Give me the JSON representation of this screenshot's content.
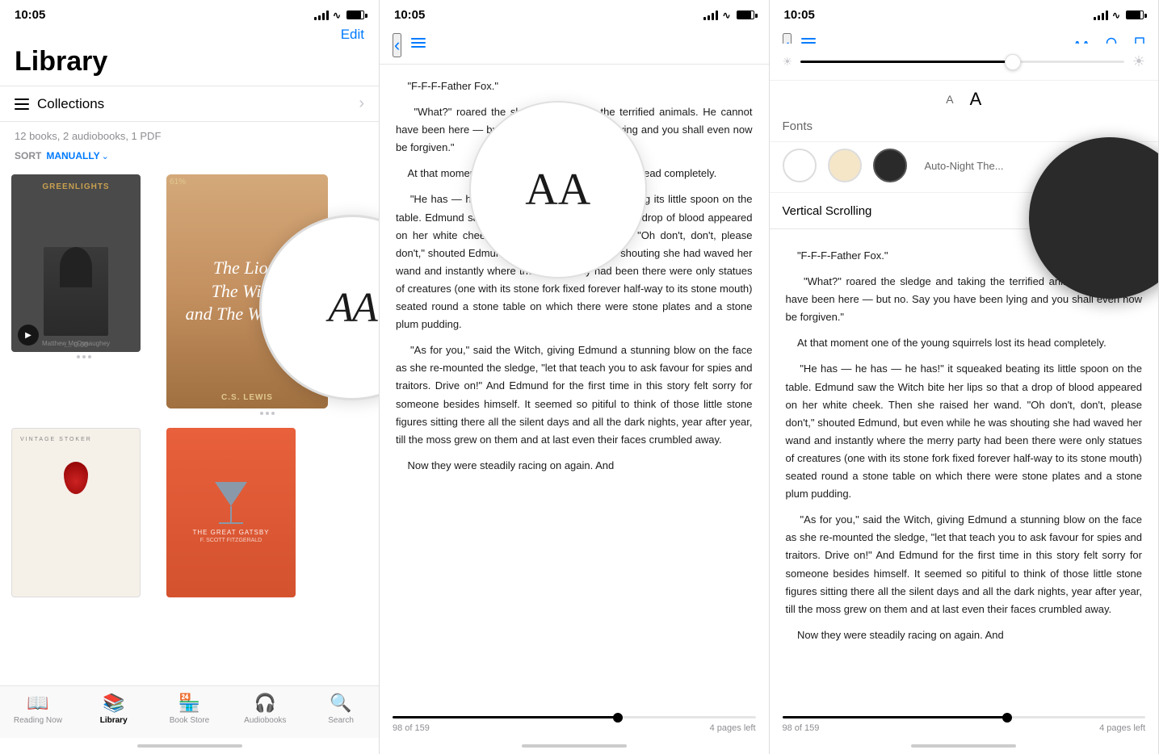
{
  "panel1": {
    "status_time": "10:05",
    "header_edit": "Edit",
    "title": "Library",
    "collections": "Collections",
    "books_count": "12 books, 2 audiobooks, 1 PDF",
    "sort_label": "SORT",
    "sort_value": "MANUALLY",
    "book1": {
      "title": "The Lion,\nThe Witch\nand The Wardrobe",
      "author": "C.S. LEWIS",
      "progress": "61%"
    },
    "book2": {
      "title": "Greenlights",
      "author": "Matthew McConaughey",
      "progress": "0:00"
    }
  },
  "panel2": {
    "status_time": "10:05",
    "reading_text_1": "\"F-F-F-Father Fox.\"",
    "reading_text_2": "\"What?\" roared the sledge and taking the terrified animals. He cannot have been here — but no. Say you have been lying and you shall even now be forgiven.\"",
    "reading_text_3": "At that moment one of the young squirrels lost its head completely.",
    "reading_text_4": "\"He has — he has — he has!\" it squeaked beating its little spoon on the table. Edmund saw the Witch bite her lips so that a drop of blood appeared on her white cheek. Then she raised her wand. \"Oh don't, don't, please don't,\" shouted Edmund, but even while he was shouting she had waved her wand and instantly where the merry party had been there were only statues of creatures (one with its stone fork fixed forever half-way to its stone mouth) seated round a stone table on which there were stone plates and a stone plum pudding.",
    "reading_text_5": "\"As for you,\" said the Witch, giving Edmund a stunning blow on the face as she re-mounted the sledge, \"let that teach you to ask favour for spies and traitors. Drive on!\" And Edmund for the first time in this story felt sorry for someone besides himself. It seemed so pitiful to think of those little stone figures sitting there all the silent days and all the dark nights, year after year, till the moss grew on them and at last even their faces crumbled away.",
    "reading_text_6": "Now they were steadily racing on again. And",
    "aa_display": "AA",
    "progress_current": "98 of 159",
    "progress_pages_left": "4 pages left",
    "progress_pct": 62
  },
  "panel3": {
    "status_time": "10:05",
    "reading_text_1": "\"F-F-F",
    "reading_text_2": "Fox.\"",
    "reading_text_3": "\"What",
    "reading_text_4": "the sled",
    "fonts_label": "Fonts",
    "font_display": "A",
    "auto_night_label": "Auto-Night The...",
    "vertical_scroll_label": "Vertical Scrolling",
    "progress_current": "98 of 159",
    "progress_pages_left": "4 pages left",
    "progress_pct": 62,
    "brightness_level": 65
  },
  "nav": {
    "reading_now": "Reading Now",
    "library": "Library",
    "book_store": "Book Store",
    "audiobooks": "Audiobooks",
    "search": "Search"
  }
}
